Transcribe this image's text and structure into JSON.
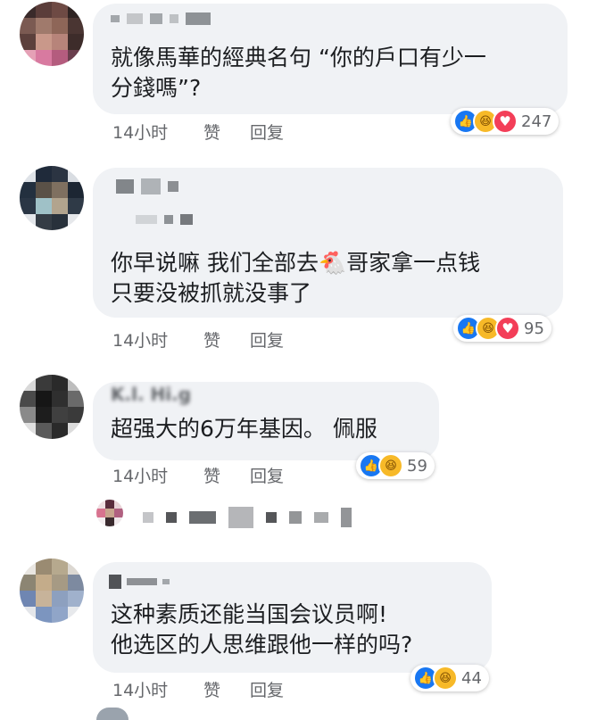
{
  "comments": [
    {
      "text_lines": [
        "就像馬華的經典名句 “你的戶口有少一",
        "分錢嗎”?"
      ],
      "time": "14小时",
      "like": "赞",
      "reply": "回复",
      "reaction_count": "247",
      "reactions": [
        "like-icon",
        "haha-icon",
        "love-icon"
      ]
    },
    {
      "text_lines": [
        "你早说嘛 我们全部去🐔哥家拿一点钱",
        "只要没被抓就没事了"
      ],
      "time": "14小时",
      "like": "赞",
      "reply": "回复",
      "reaction_count": "95",
      "reactions": [
        "like-icon",
        "haha-icon",
        "love-icon"
      ]
    },
    {
      "name_partial": "K.l. Hi.g",
      "text_lines": [
        "超强大的6万年基因。 佩服"
      ],
      "time": "14小时",
      "like": "赞",
      "reply": "回复",
      "reaction_count": "59",
      "reactions": [
        "like-icon",
        "haha-icon"
      ]
    },
    {
      "text_lines": [
        "这种素质还能当国会议员啊!",
        "他选区的人思维跟他一样的吗?"
      ],
      "time": "14小时",
      "like": "赞",
      "reply": "回复",
      "reaction_count": "44",
      "reactions": [
        "like-icon",
        "haha-icon"
      ]
    }
  ],
  "colors": {
    "bubble": "#f0f2f5",
    "meta_text": "#65676b",
    "like_blue": "#1877f2",
    "haha_yellow": "#f7b928",
    "love_red": "#f33e58"
  }
}
